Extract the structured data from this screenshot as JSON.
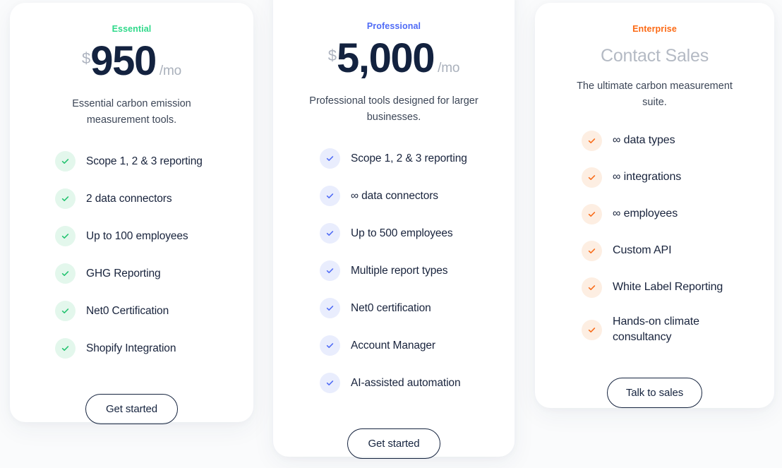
{
  "theme": {
    "page_background": "#fafbfc",
    "card_background": "#ffffff",
    "text_dark": "#16243f",
    "muted_text": "#b4bac4"
  },
  "plans": [
    {
      "id": "essential",
      "eyebrow": "Essential",
      "accent_color": "#2fd98a",
      "check_color": "#22c36f",
      "badge_color": "#e3f7ec",
      "currency": "$",
      "amount": "950",
      "period": "/mo",
      "tagline": "Essential carbon emission measurement tools.",
      "features": [
        "Scope 1, 2 & 3 reporting",
        "2 data connectors",
        "Up to 100 employees",
        "GHG Reporting",
        "Net0 Certification",
        "Shopify Integration"
      ],
      "cta_label": "Get started"
    },
    {
      "id": "professional",
      "eyebrow": "Professional",
      "accent_color": "#4f6bf6",
      "check_color": "#4f6bf6",
      "badge_color": "#e9edfd",
      "currency": "$",
      "amount": "5,000",
      "period": "/mo",
      "tagline": "Professional tools designed for larger businesses.",
      "features": [
        "Scope 1, 2 & 3 reporting",
        "∞ data connectors",
        "Up to 500 employees",
        "Multiple report types",
        "Net0 certification",
        "Account Manager",
        "AI-assisted automation"
      ],
      "cta_label": "Get started"
    },
    {
      "id": "enterprise",
      "eyebrow": "Enterprise",
      "accent_color": "#fc6a15",
      "check_color": "#f96a16",
      "badge_color": "#fdeee2",
      "contact_label": "Contact Sales",
      "tagline": "The ultimate carbon measurement suite.",
      "features": [
        "∞ data types",
        "∞ integrations",
        "∞ employees",
        "Custom API",
        "White Label Reporting",
        "Hands-on climate consultancy"
      ],
      "cta_label": "Talk to sales"
    }
  ]
}
